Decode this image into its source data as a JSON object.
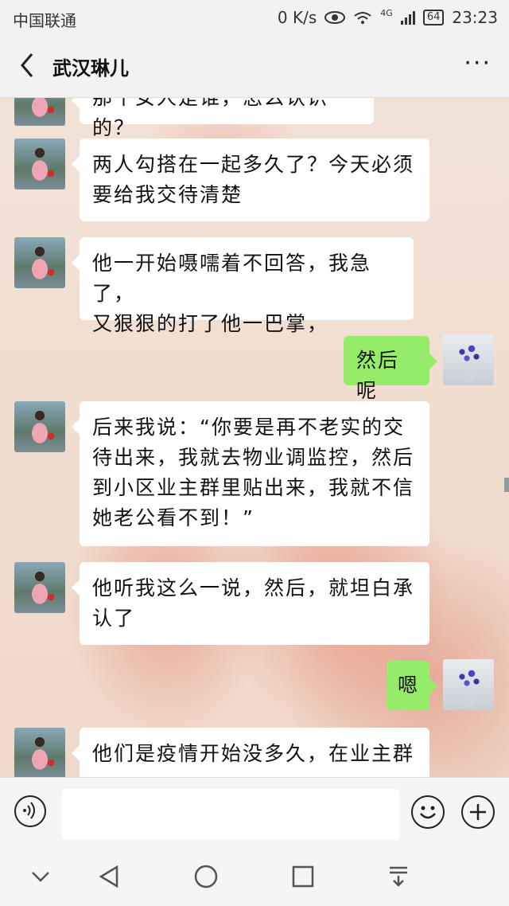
{
  "statusbar": {
    "carrier": "中国联通",
    "net_speed": "0 K/s",
    "network": "4G",
    "battery": "64",
    "time": "23:23"
  },
  "header": {
    "title": "武汉琳儿",
    "back_icon": "chevron-left-icon",
    "more_icon": "more-horizontal-icon",
    "more_label": "···"
  },
  "messages": [
    {
      "side": "left",
      "lines": [
        "那个女人是谁，怎么认识的？"
      ]
    },
    {
      "side": "left",
      "lines": [
        "两人勾搭在一起多久了？今天必须",
        "要给我交待清楚"
      ]
    },
    {
      "side": "left",
      "lines": [
        "他一开始嗫嚅着不回答，我急了，",
        "又狠狠的打了他一巴掌，"
      ]
    },
    {
      "side": "right",
      "lines": [
        "然后呢"
      ]
    },
    {
      "side": "left",
      "lines": [
        "后来我说：“你要是再不老实的交",
        "待出来，我就去物业调监控，然后",
        "到小区业主群里贴出来，我就不信",
        "她老公看不到！”"
      ]
    },
    {
      "side": "left",
      "lines": [
        "他听我这么一说，然后，就坦白承",
        "认了"
      ]
    },
    {
      "side": "right",
      "lines": [
        "嗯"
      ]
    },
    {
      "side": "left",
      "lines": [
        "他们是疫情开始没多久，在业主群"
      ]
    }
  ],
  "input_bar": {
    "voice_icon": "voice-icon",
    "emoji_icon": "emoji-icon",
    "plus_icon": "plus-icon",
    "placeholder": ""
  },
  "navbar": [
    "chevron-down-icon",
    "back-triangle-icon",
    "home-circle-icon",
    "recents-square-icon",
    "notification-down-icon"
  ],
  "colors": {
    "right_bubble": "#95ec69",
    "left_bubble": "#ffffff",
    "header_bg": "#f2f2f2"
  }
}
